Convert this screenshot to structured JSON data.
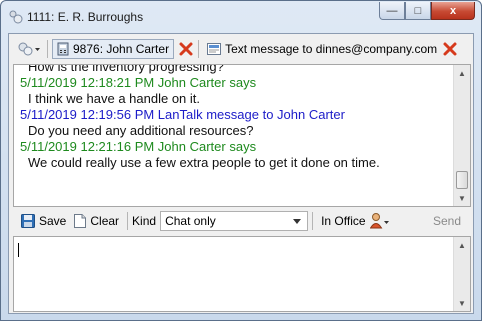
{
  "window": {
    "title": "1111: E. R. Burroughs",
    "minimize_glyph": "—",
    "maximize_glyph": "□",
    "close_glyph": "x"
  },
  "top_toolbar": {
    "contact_tab_label": "9876: John Carter",
    "text_tab_label": "Text message to dinnes@company.com"
  },
  "messages": [
    {
      "kind": "body",
      "text": "How is the inventory progressing?"
    },
    {
      "kind": "head",
      "color": "green",
      "text": "5/11/2019 12:18:21 PM John Carter says"
    },
    {
      "kind": "body",
      "text": "I think we have a handle on it."
    },
    {
      "kind": "head",
      "color": "blue",
      "text": "5/11/2019 12:19:56 PM LanTalk message to John Carter"
    },
    {
      "kind": "body",
      "text": "Do you need any additional resources?"
    },
    {
      "kind": "head",
      "color": "green",
      "text": "5/11/2019 12:21:16 PM John Carter says"
    },
    {
      "kind": "body",
      "text": "We could really use a few extra people to get it done on time."
    }
  ],
  "bottom_toolbar": {
    "save_label": "Save",
    "clear_label": "Clear",
    "kind_label": "Kind",
    "kind_value": "Chat only",
    "status_label": "In Office",
    "send_label": "Send"
  },
  "compose": {
    "value": ""
  },
  "colors": {
    "green_header": "#1e8a1e",
    "blue_header": "#1c1cc8",
    "close_red": "#c74a33"
  },
  "icons": [
    "app-icon",
    "minimize-icon",
    "maximize-icon",
    "close-icon",
    "contacts-dropdown-icon",
    "phone-icon",
    "close-tab-icon",
    "message-icon",
    "save-icon",
    "clear-icon",
    "status-person-icon",
    "dropdown-arrow-icon"
  ]
}
